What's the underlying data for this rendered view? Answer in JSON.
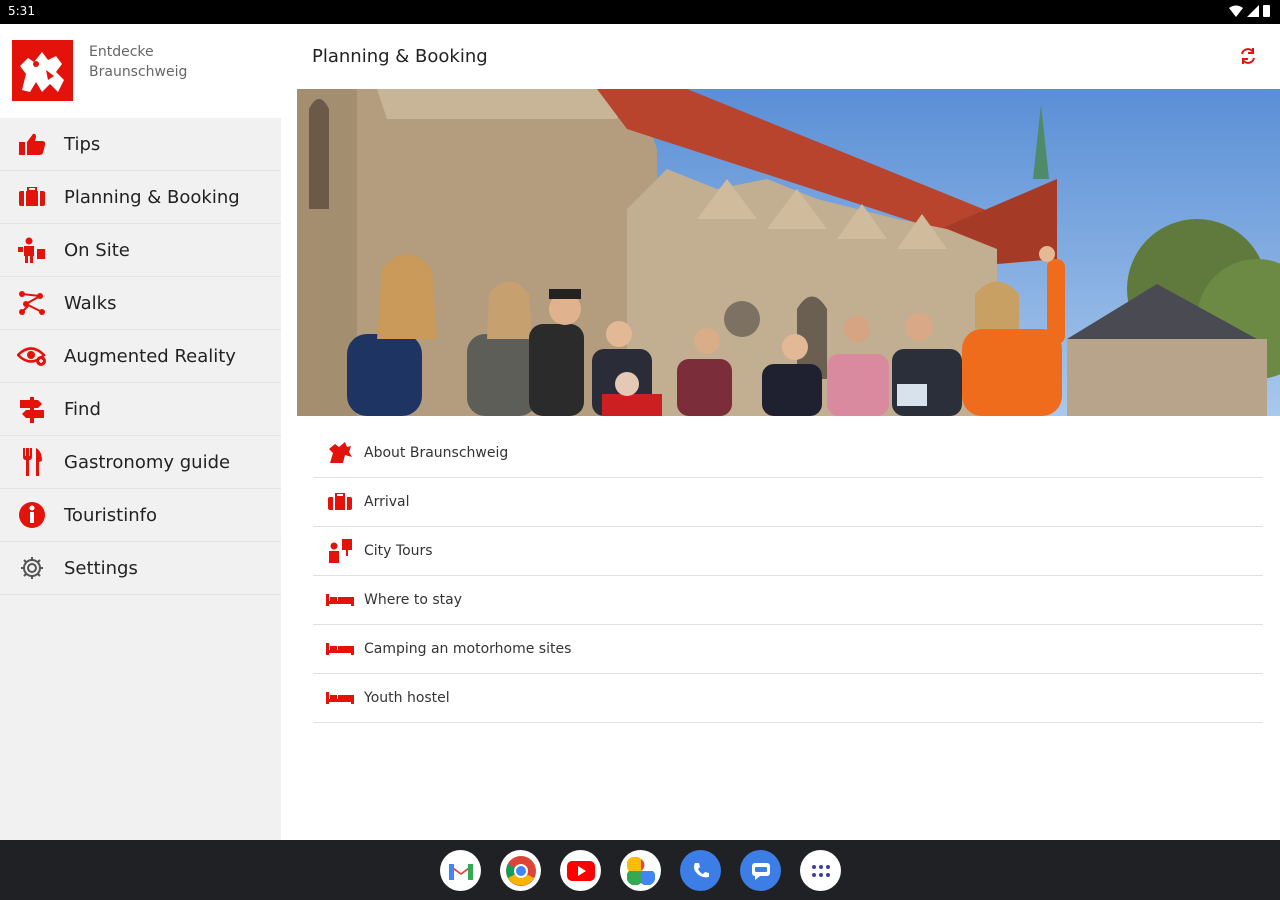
{
  "status": {
    "time": "5:31"
  },
  "drawer": {
    "app_title": "Entdecke Braunschweig",
    "items": [
      {
        "label": "Tips",
        "icon": "thumbs-up-icon"
      },
      {
        "label": "Planning & Booking",
        "icon": "suitcase-icon"
      },
      {
        "label": "On Site",
        "icon": "person-info-icon"
      },
      {
        "label": "Walks",
        "icon": "route-icon"
      },
      {
        "label": "Augmented Reality",
        "icon": "ar-eye-icon"
      },
      {
        "label": "Find",
        "icon": "signpost-icon"
      },
      {
        "label": "Gastronomy guide",
        "icon": "cutlery-icon"
      },
      {
        "label": "Touristinfo",
        "icon": "info-icon"
      },
      {
        "label": "Settings",
        "icon": "gear-icon"
      }
    ]
  },
  "main": {
    "title": "Planning & Booking",
    "list": [
      {
        "label": "About Braunschweig",
        "icon": "lion-icon"
      },
      {
        "label": "Arrival",
        "icon": "suitcase-icon"
      },
      {
        "label": "City Tours",
        "icon": "guide-icon"
      },
      {
        "label": "Where to stay",
        "icon": "bed-icon"
      },
      {
        "label": "Camping an motorhome sites",
        "icon": "bed-icon"
      },
      {
        "label": "Youth hostel",
        "icon": "bed-icon"
      }
    ]
  },
  "dock": {
    "apps": [
      "gmail-icon",
      "chrome-icon",
      "youtube-icon",
      "photos-icon",
      "phone-icon",
      "messages-icon",
      "app-drawer-icon"
    ]
  },
  "colors": {
    "accent": "#e3120b",
    "drawer_bg": "#f1f1f1",
    "dock_bg": "#202124"
  }
}
